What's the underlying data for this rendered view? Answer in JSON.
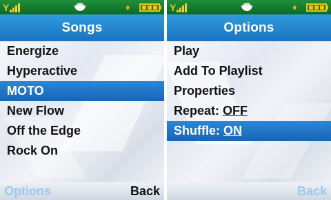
{
  "left_screen": {
    "title": "Songs",
    "items": [
      "Energize",
      "Hyperactive",
      "MOTO",
      "New Flow",
      "Off the Edge",
      "Rock On"
    ],
    "selected_index": 2,
    "softkeys": {
      "left": "Options",
      "right": "Back"
    }
  },
  "right_screen": {
    "title": "Options",
    "items": [
      {
        "label": "Play",
        "value": ""
      },
      {
        "label": "Add To Playlist",
        "value": ""
      },
      {
        "label": "Properties",
        "value": ""
      },
      {
        "label": "Repeat: ",
        "value": "OFF"
      },
      {
        "label": "Shuffle: ",
        "value": "ON"
      }
    ],
    "selected_index": 4,
    "softkeys": {
      "left": "",
      "right": "Back"
    }
  },
  "colors": {
    "status_bar": "#0b6a26",
    "title_bar": "#1b73c2",
    "selection": "#1a64b6",
    "battery": "#f2c21a"
  },
  "icons": [
    "signal-strength-icon",
    "message-icon",
    "battery-icon"
  ]
}
